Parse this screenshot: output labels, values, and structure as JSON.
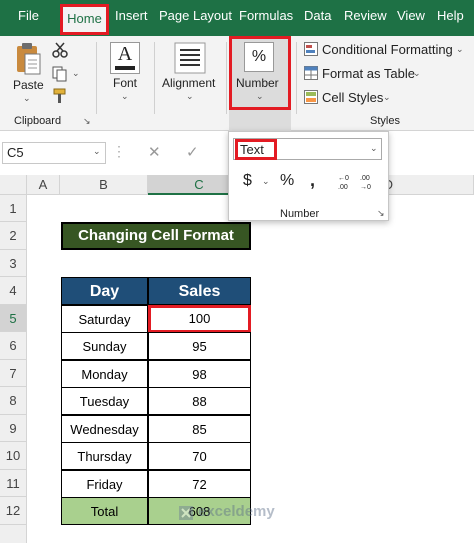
{
  "tabs": [
    "File",
    "Home",
    "Insert",
    "Page Layout",
    "Formulas",
    "Data",
    "Review",
    "View",
    "Help"
  ],
  "ribbon": {
    "clipboard": {
      "paste_label": "Paste",
      "group_label": "Clipboard"
    },
    "font": {
      "label": "Font",
      "icon_glyph": "A"
    },
    "alignment": {
      "label": "Alignment"
    },
    "number": {
      "label": "Number",
      "icon_glyph": "%"
    },
    "styles": {
      "conditional_formatting": "Conditional Formatting",
      "format_as_table": "Format as Table",
      "cell_styles": "Cell Styles",
      "group_label": "Styles"
    }
  },
  "formula_bar": {
    "name_box": "C5"
  },
  "number_popup": {
    "format_value": "Text",
    "currency_symbol": "$",
    "percent_symbol": "%",
    "comma_symbol": ",",
    "group_label": "Number"
  },
  "grid": {
    "columns": [
      "A",
      "B",
      "C",
      "D"
    ],
    "rows": [
      "1",
      "2",
      "3",
      "4",
      "5",
      "6",
      "7",
      "8",
      "9",
      "10",
      "11",
      "12"
    ]
  },
  "sheet": {
    "title": "Changing Cell Format",
    "headers": [
      "Day",
      "Sales"
    ],
    "rows": [
      {
        "day": "Saturday",
        "sales": "100"
      },
      {
        "day": "Sunday",
        "sales": "95"
      },
      {
        "day": "Monday",
        "sales": "98"
      },
      {
        "day": "Tuesday",
        "sales": "88"
      },
      {
        "day": "Wednesday",
        "sales": "85"
      },
      {
        "day": "Thursday",
        "sales": "70"
      },
      {
        "day": "Friday",
        "sales": "72"
      }
    ],
    "total_label": "Total",
    "total_value": "608"
  },
  "watermark": "exceldemy",
  "colors": {
    "excel_green": "#1e7145",
    "highlight_red": "#e31b23",
    "header_blue": "#1f4e78",
    "title_green": "#375623",
    "total_green": "#a9d08e"
  }
}
